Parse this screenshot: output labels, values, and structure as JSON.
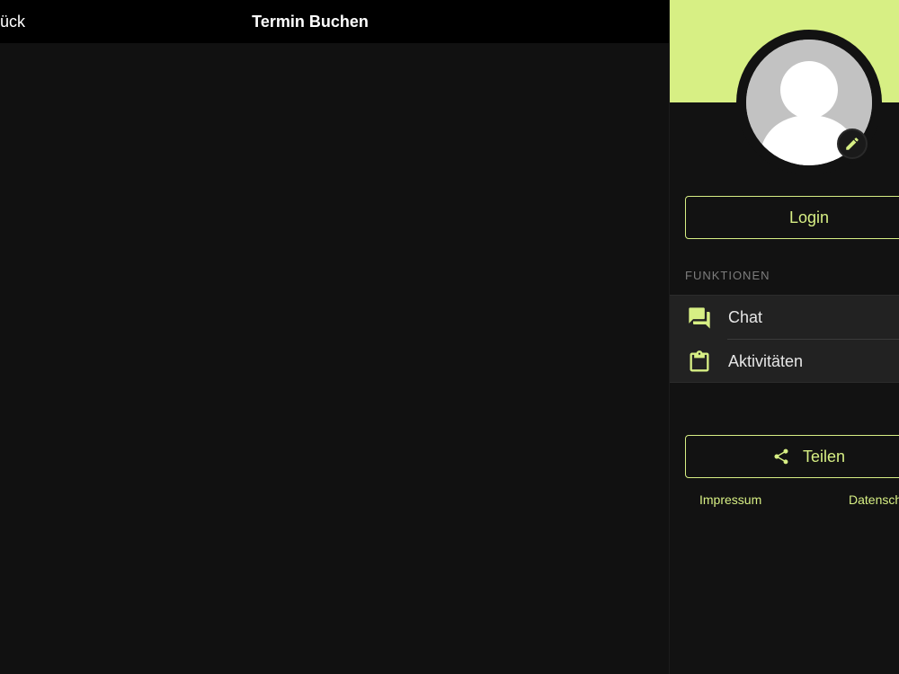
{
  "topbar": {
    "back_label": "Zurück",
    "title": "Termin Buchen"
  },
  "drawer": {
    "login_label": "Login",
    "section_label": "FUNKTIONEN",
    "menu": [
      {
        "label": "Chat",
        "icon": "chat-icon"
      },
      {
        "label": "Aktivitäten",
        "icon": "clipboard-icon"
      }
    ],
    "share_label": "Teilen",
    "footer": {
      "impressum": "Impressum",
      "datenschutz": "Datenschutz"
    }
  },
  "colors": {
    "accent": "#d7ef84",
    "background": "#111111",
    "topbar": "#000000",
    "menu_background": "#222222",
    "avatar_placeholder": "#c2c2c2"
  }
}
